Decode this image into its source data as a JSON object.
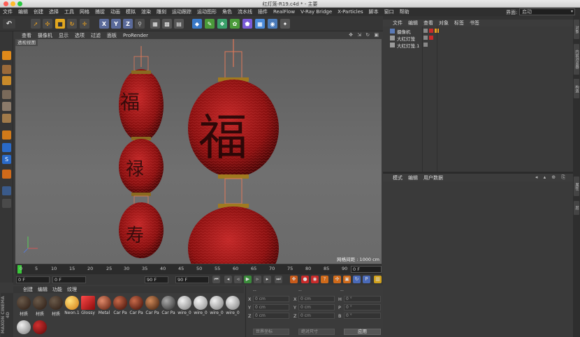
{
  "window": {
    "title": "红灯笼-R19.c4d * - 主要"
  },
  "menu": [
    "文件",
    "编辑",
    "创建",
    "选择",
    "工具",
    "网格",
    "捕捉",
    "动画",
    "模拟",
    "渲染",
    "雕刻",
    "运动跟踪",
    "运动图形",
    "角色",
    "流水线",
    "插件",
    "RealFlow",
    "V-Ray Bridge",
    "X-Particles",
    "脚本",
    "窗口",
    "帮助"
  ],
  "layout": {
    "label": "界面:",
    "value": "启动"
  },
  "toolbar": {
    "x": "X",
    "y": "Y",
    "z": "Z"
  },
  "viewport": {
    "menu": [
      "查看",
      "摄像机",
      "显示",
      "选项",
      "过滤",
      "面板",
      "ProRender"
    ],
    "label": "透视视图",
    "grid_label": "网格间距 : 1000 cm"
  },
  "timeline": {
    "ticks": [
      "0",
      "5",
      "10",
      "15",
      "20",
      "25",
      "30",
      "35",
      "40",
      "45",
      "50",
      "55",
      "60",
      "65",
      "70",
      "75",
      "80",
      "85",
      "90"
    ],
    "current_frame": "0 F"
  },
  "playback": {
    "start": "0 F",
    "current": "0 F",
    "end": "90 F",
    "end2": "90 F"
  },
  "materials": {
    "menu": [
      "创建",
      "编辑",
      "功能",
      "纹理"
    ],
    "items": [
      {
        "name": "材质",
        "color": "#3a2a22"
      },
      {
        "name": "材质",
        "color": "#3a2a22"
      },
      {
        "name": "材质",
        "color": "#3a2a22"
      },
      {
        "name": "Neon.1",
        "color": "#f0a020"
      },
      {
        "name": "Glossy",
        "color": "#cc1a1a"
      },
      {
        "name": "Metal",
        "color": "#b04a30"
      },
      {
        "name": "Car Pa",
        "color": "#7a2a18"
      },
      {
        "name": "Car Pa",
        "color": "#7a2a18"
      },
      {
        "name": "Car Pa",
        "color": "#6a3018"
      },
      {
        "name": "Car Pa",
        "color": "#555555"
      },
      {
        "name": "wire_0",
        "color": "#bdbdbd"
      },
      {
        "name": "wire_0",
        "color": "#c8c8c8"
      },
      {
        "name": "wire_0",
        "color": "#bdbdbd"
      },
      {
        "name": "wire_0",
        "color": "#bdbdbd"
      }
    ],
    "row2": [
      {
        "color": "#c9c9c9"
      },
      {
        "color": "#a01818"
      }
    ],
    "brand": "MAXON CINEMA 4D"
  },
  "coords": {
    "headers": [
      "位置",
      "尺寸",
      "旋转"
    ],
    "rows": [
      {
        "axis": "X",
        "pos": "0 cm",
        "axis2": "X",
        "size": "0 cm",
        "rot_label": "H",
        "rot": "0 °"
      },
      {
        "axis": "Y",
        "pos": "0 cm",
        "axis2": "Y",
        "size": "0 cm",
        "rot_label": "P",
        "rot": "0 °"
      },
      {
        "axis": "Z",
        "pos": "0 cm",
        "axis2": "Z",
        "size": "0 cm",
        "rot_label": "B",
        "rot": "0 °"
      }
    ],
    "mode": "世界坐标",
    "size_mode": "绝对尺寸",
    "apply": "应用"
  },
  "objects": {
    "menu": [
      "文件",
      "编辑",
      "查看",
      "对象",
      "标签",
      "书签"
    ],
    "items": [
      {
        "name": "摄像机"
      },
      {
        "name": "大红灯笼"
      },
      {
        "name": "大红灯笼.1"
      }
    ]
  },
  "attributes": {
    "menu": [
      "模式",
      "编辑",
      "用户数据"
    ]
  },
  "right_tabs": [
    "对象",
    "内容浏览器",
    "构造",
    "属性",
    "层"
  ]
}
